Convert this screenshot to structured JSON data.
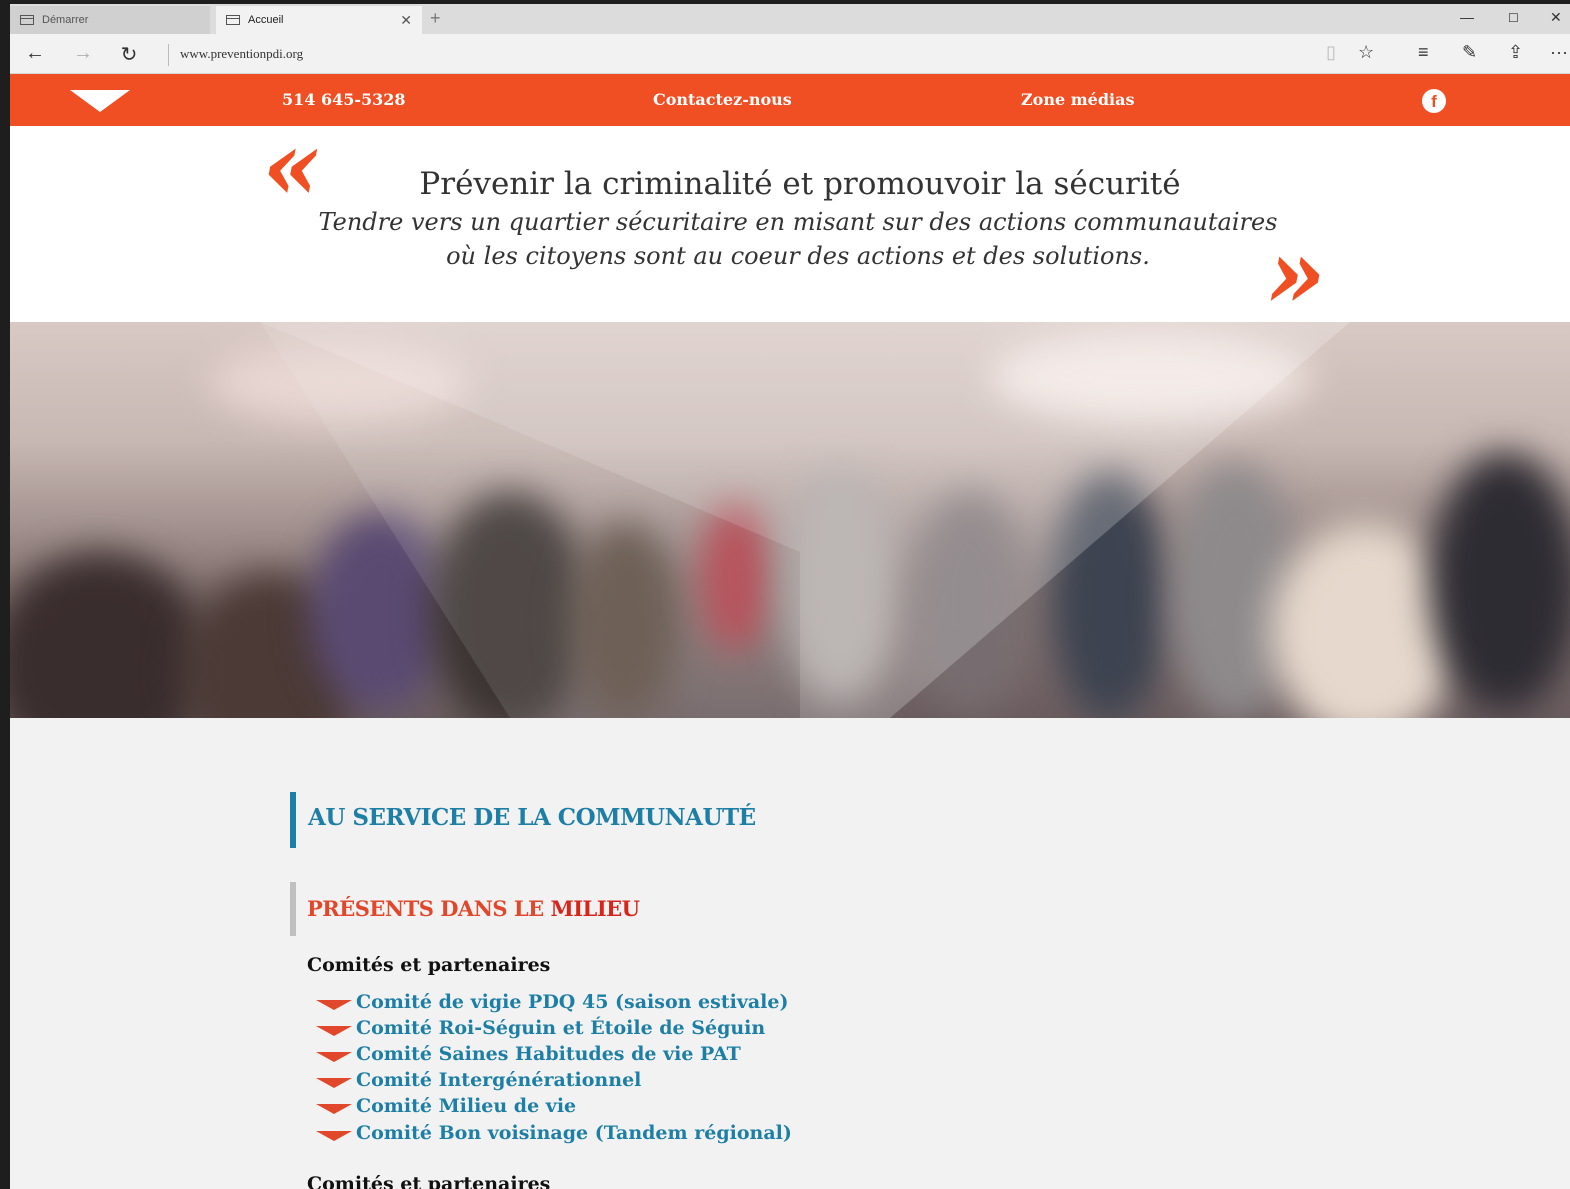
{
  "browser": {
    "tabs": [
      {
        "label": "Démarrer"
      },
      {
        "label": "Accueil"
      }
    ],
    "url": "www.preventionpdi.org"
  },
  "site": {
    "nav": {
      "phone": "514 645-5328",
      "contact": "Contactez-nous",
      "media": "Zone médias"
    },
    "quote": {
      "open_mark": "«",
      "close_mark": "»",
      "title": "Prévenir la criminalité et promouvoir la sécurité",
      "line1": "Tendre vers un quartier sécuritaire en misant sur des actions communautaires",
      "line2": "où les citoyens sont au coeur des actions et des solutions."
    },
    "section": {
      "heading": "AU SERVICE DE LA COMMUNAUTÉ",
      "subheading_prefix": "PRÉSENTS DANS LE ",
      "subheading_emph": "MILIEU",
      "group_title": "Comités et partenaires",
      "items": [
        "Comité de vigie PDQ 45 (saison estivale)",
        "Comité Roi-Séguin et Étoile de Séguin",
        "Comité Saines Habitudes de vie PAT",
        "Comité Intergénérationnel",
        "Comité Milieu de vie",
        "Comité Bon voisinage (Tandem régional)"
      ],
      "group_title_2": "Comités et partenaires"
    }
  },
  "colors": {
    "brand_orange": "#f04e23",
    "heading_blue": "#1e7fa6",
    "heading_red": "#e0472b"
  }
}
